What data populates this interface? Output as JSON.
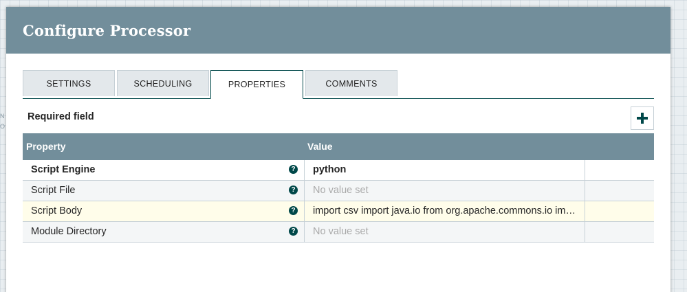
{
  "canvas_background": {
    "snippet_lines": [
      "N",
      "O"
    ]
  },
  "dialog": {
    "title": "Configure Processor"
  },
  "tabs": [
    {
      "label": "SETTINGS",
      "active": false
    },
    {
      "label": "SCHEDULING",
      "active": false
    },
    {
      "label": "PROPERTIES",
      "active": true
    },
    {
      "label": "COMMENTS",
      "active": false
    }
  ],
  "properties_panel": {
    "required_label": "Required field",
    "add_button_icon": "plus-icon",
    "columns": {
      "property": "Property",
      "value": "Value"
    },
    "rows": [
      {
        "name": "Script Engine",
        "value": "python",
        "required": true,
        "value_set": true
      },
      {
        "name": "Script File",
        "value": "No value set",
        "required": false,
        "value_set": false
      },
      {
        "name": "Script Body",
        "value": "import csv import java.io from org.apache.commons.io im…",
        "required": false,
        "value_set": true
      },
      {
        "name": "Module Directory",
        "value": "No value set",
        "required": false,
        "value_set": false
      }
    ],
    "help_icon_glyph": "?"
  },
  "colors": {
    "header_bg": "#728e9b",
    "accent": "#004849",
    "highlight_row": "#fffdea"
  }
}
